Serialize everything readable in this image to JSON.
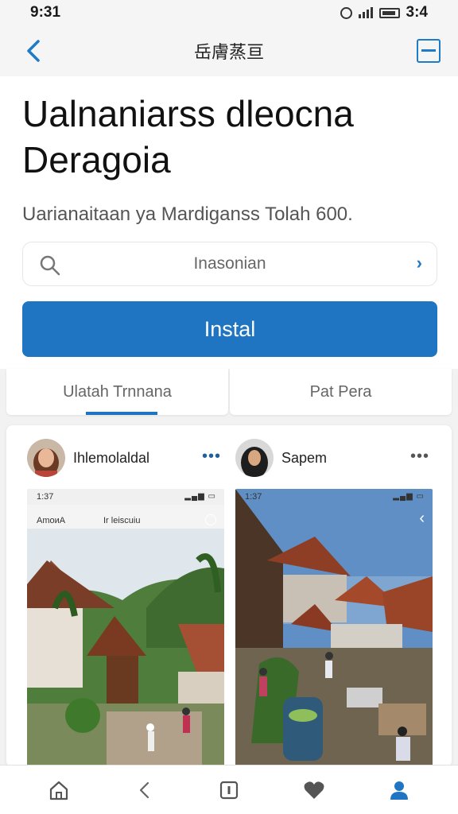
{
  "status_bar": {
    "time": "9:31",
    "battery": "3:4"
  },
  "top_bar": {
    "title": "岳膚蒸亘"
  },
  "headline": "Ualnaniarss dleocna Deragoia",
  "subtitle": "Uarianaitaan ya Mardiganss Tolah 600.",
  "search": {
    "placeholder": "Inasonian"
  },
  "install_label": "Instal",
  "tabs": [
    {
      "label": "Ulatah Trnnana"
    },
    {
      "label": "Pat Pera"
    }
  ],
  "posts": [
    {
      "username": "Ihlemolaldal",
      "more": "•••",
      "shot_time": "1:37",
      "shot_caption_left": "AmoиA",
      "shot_caption_right": "Ir leiscuiu"
    },
    {
      "username": "Sapem",
      "more": "•••",
      "shot_time": "1:37"
    }
  ],
  "bottom_nav": [
    "home-icon",
    "back-icon",
    "square-icon",
    "heart-icon",
    "profile-icon"
  ],
  "colors": {
    "accent": "#1f75c2",
    "background": "#f2f2f2"
  }
}
